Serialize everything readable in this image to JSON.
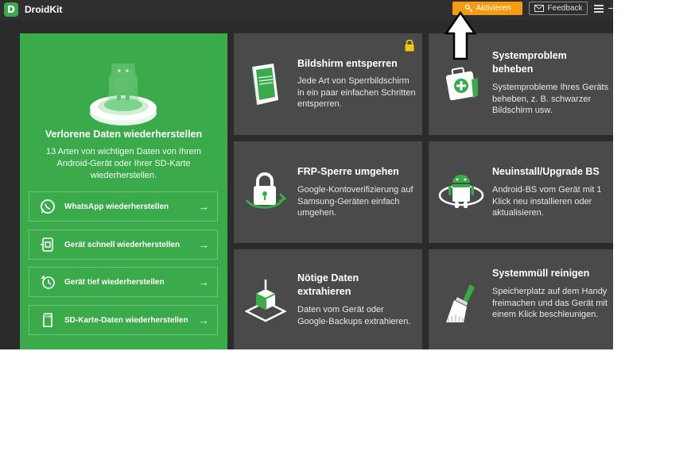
{
  "app": {
    "title": "DroidKit",
    "logo_letter": "D"
  },
  "header": {
    "activate_label": "Aktivieren",
    "feedback_label": "Feedback"
  },
  "left_panel": {
    "title": "Verlorene Daten wiederherstellen",
    "description": "13 Arten von wichtigen Daten von Ihrem Android-Gerät oder Ihrer SD-Karte wiederherstellen.",
    "items": [
      {
        "label": "WhatsApp wiederherstellen",
        "icon": "whatsapp-icon"
      },
      {
        "label": "Gerät schnell wiederherstellen",
        "icon": "quick-recover-icon"
      },
      {
        "label": "Gerät tief wiederherstellen",
        "icon": "deep-recover-icon"
      },
      {
        "label": "SD-Karte-Daten wiederherstellen",
        "icon": "sd-card-icon"
      }
    ]
  },
  "cards": [
    {
      "title": "Bildshirm entsperren",
      "description": "Jede Art von Sperrbildschirm in ein paar einfachen Schritten entsperren.",
      "icon": "unlock-screen-icon",
      "locked": true
    },
    {
      "title": "Systemproblem beheben",
      "description": "Systemprobleme Ihres Geräts beheben, z. B. schwarzer Bildschirm usw.",
      "icon": "first-aid-kit-icon"
    },
    {
      "title": "FRP-Sperre umgehen",
      "description": "Google-Kontoverifizierung auf Samsung-Geräten einfach umgehen.",
      "icon": "padlock-icon"
    },
    {
      "title": "Neuinstall/Upgrade BS",
      "description": "Android-BS vom Gerät mit 1 Klick neu installieren oder aktualisieren.",
      "icon": "android-robot-icon"
    },
    {
      "title": "Nötige Daten extrahieren",
      "description": "Daten vom Gerät oder Google-Backups extrahieren.",
      "icon": "extract-box-icon"
    },
    {
      "title": "Systemmüll reinigen",
      "description": "Speicherplatz auf dem Handy freimachen und das Gerät mit einem Klick beschleunigen.",
      "icon": "broom-icon"
    }
  ],
  "colors": {
    "green": "#3aaa4b",
    "orange": "#f39c12",
    "card": "#4a4a4a",
    "background": "#2b2b2b"
  }
}
